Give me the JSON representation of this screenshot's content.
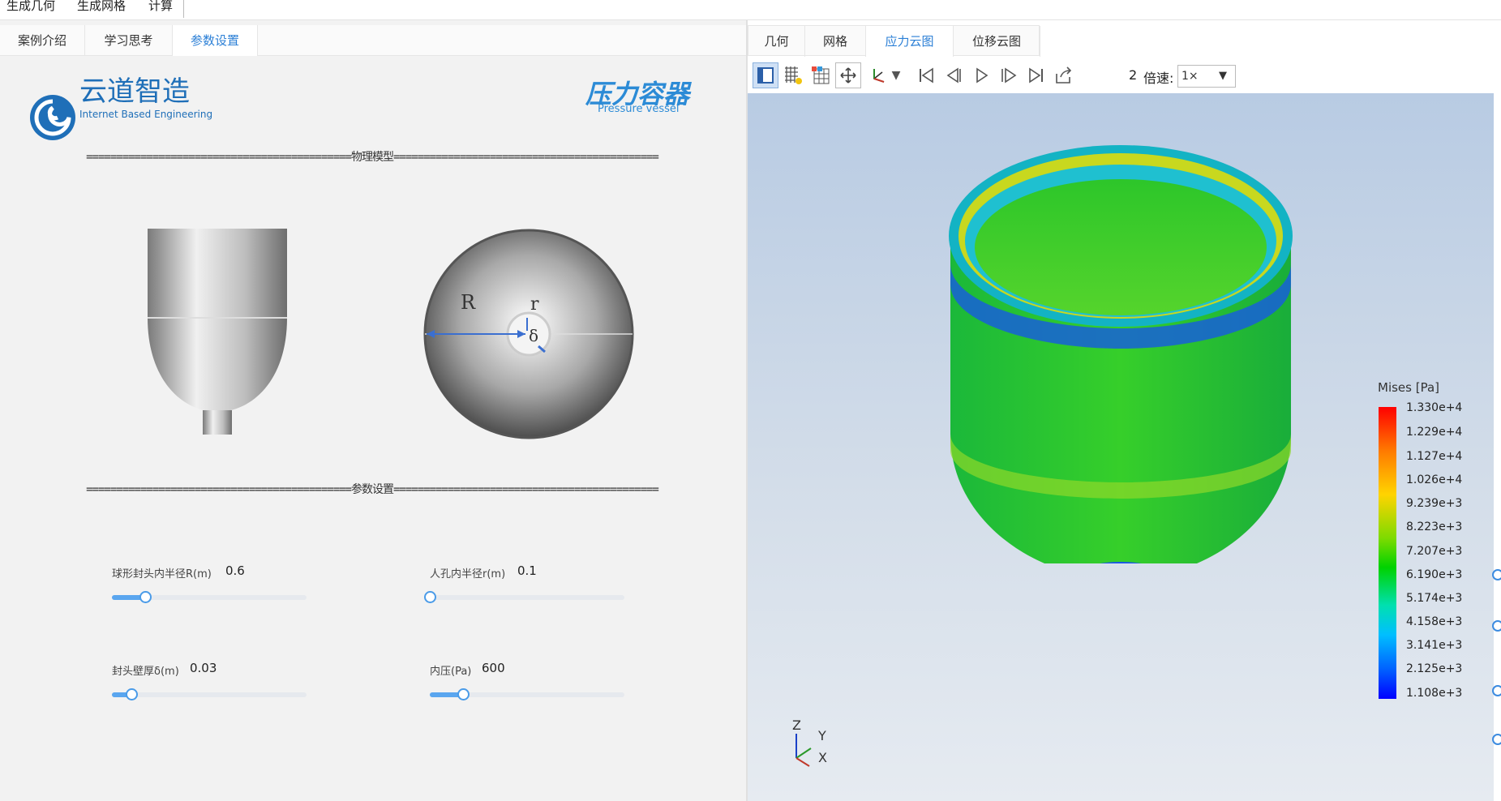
{
  "top_menu": {
    "items": [
      "生成几何",
      "生成网格",
      "计算"
    ]
  },
  "left_tabs": [
    "案例介绍",
    "学习思考",
    "参数设置"
  ],
  "left_active_tab": "参数设置",
  "brand": {
    "name": "云道智造",
    "subtitle": "Internet Based Engineering",
    "product": "压力容器",
    "product_sub": "Pressure vessel"
  },
  "dividers": {
    "model": "============================================物理模型============================================",
    "params": "============================================参数设置============================================"
  },
  "diagram": {
    "R": "R",
    "r": "r",
    "delta": "δ"
  },
  "params": [
    {
      "label": "球形封头内半径R(m)",
      "value": "0.6",
      "fraction": 0.17
    },
    {
      "label": "人孔内半径r(m)",
      "value": "0.1",
      "fraction": 0.0
    },
    {
      "label": "封头壁厚δ(m)",
      "value": "0.03",
      "fraction": 0.1
    },
    {
      "label": "内压(Pa)",
      "value": "600",
      "fraction": 0.17
    }
  ],
  "right_tabs": [
    "几何",
    "网格",
    "应力云图",
    "位移云图"
  ],
  "right_active_tab": "应力云图",
  "toolbar": {
    "frame": "2",
    "speed_label": "倍速:",
    "speed_value": "1×"
  },
  "legend": {
    "title": "Mises [Pa]",
    "values": [
      "1.330e+4",
      "1.229e+4",
      "1.127e+4",
      "1.026e+4",
      "9.239e+3",
      "8.223e+3",
      "7.207e+3",
      "6.190e+3",
      "5.174e+3",
      "4.158e+3",
      "3.141e+3",
      "2.125e+3",
      "1.108e+3"
    ]
  },
  "axes": {
    "z": "Z",
    "y": "Y",
    "x": "X"
  },
  "colors": {
    "accent": "#2b7fd6",
    "slider_fill": "#5aa6ef"
  }
}
